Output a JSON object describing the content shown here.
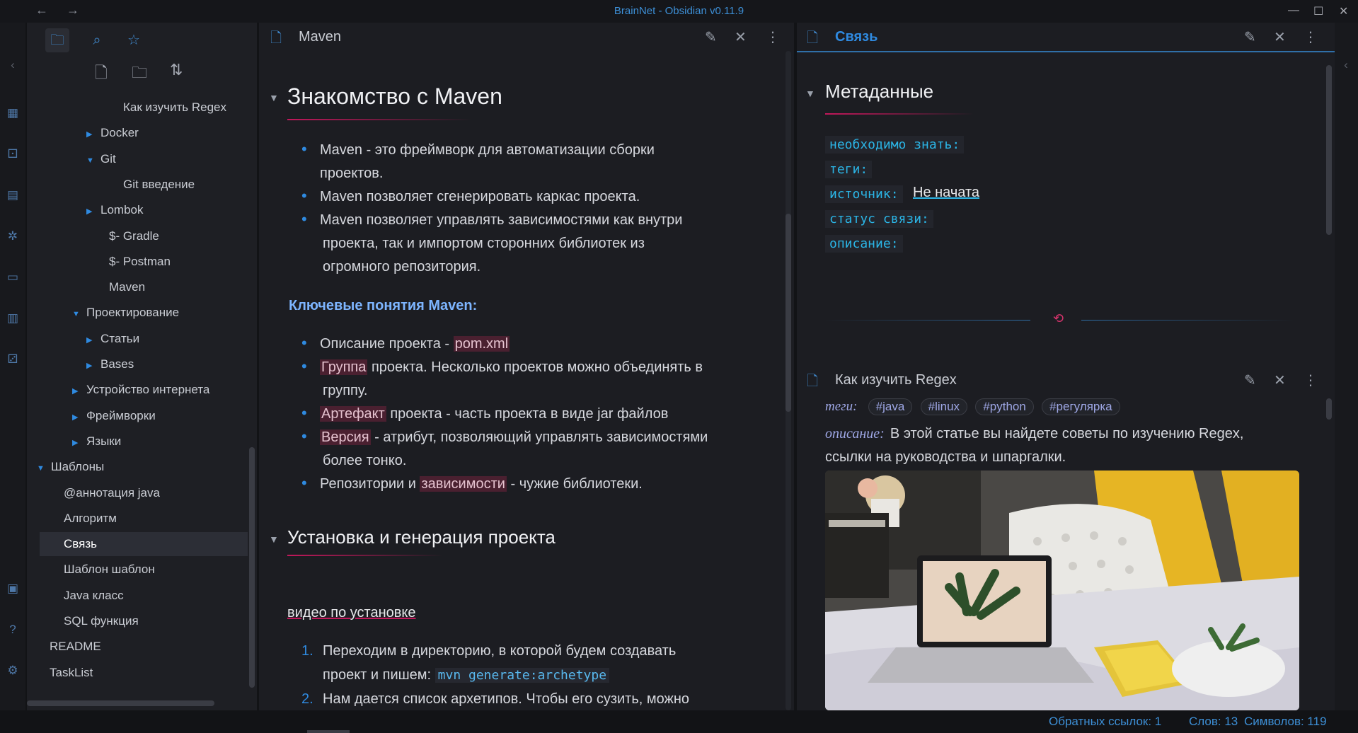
{
  "window": {
    "title": "BrainNet - Obsidian v0.11.9",
    "nav_back": "←",
    "nav_forward": "→",
    "minimize": "—",
    "maximize": "☐",
    "close": "✕"
  },
  "sidebar": {
    "tree": [
      {
        "label": "Как изучить Regex",
        "arrow": ""
      },
      {
        "label": "Docker",
        "arrow": "▶"
      },
      {
        "label": "Git",
        "arrow": "▼"
      },
      {
        "label": "Git введение",
        "arrow": ""
      },
      {
        "label": "Lombok",
        "arrow": "▶"
      },
      {
        "label": "$- Gradle",
        "arrow": ""
      },
      {
        "label": "$- Postman",
        "arrow": ""
      },
      {
        "label": "Maven",
        "arrow": ""
      },
      {
        "label": "Проектирование",
        "arrow": "▼"
      },
      {
        "label": "Статьи",
        "arrow": "▶"
      },
      {
        "label": "Bases",
        "arrow": "▶"
      },
      {
        "label": "Устройство интернета",
        "arrow": "▶"
      },
      {
        "label": "Фреймворки",
        "arrow": "▶"
      },
      {
        "label": "Языки",
        "arrow": "▶"
      },
      {
        "label": "Шаблоны",
        "arrow": "▼"
      },
      {
        "label": "@аннотация java",
        "arrow": ""
      },
      {
        "label": "Алгоритм",
        "arrow": ""
      },
      {
        "label": "Связь",
        "arrow": ""
      },
      {
        "label": "Шаблон шаблон",
        "arrow": ""
      },
      {
        "label": "Java класс",
        "arrow": ""
      },
      {
        "label": "SQL функция",
        "arrow": ""
      },
      {
        "label": "README",
        "arrow": ""
      },
      {
        "label": "TaskList",
        "arrow": ""
      }
    ]
  },
  "main": {
    "tab_title": "Maven",
    "h1": "Знакомство с Maven",
    "bullets1": [
      "Maven - это фреймворк для автоматизации сборки",
      "проектов.",
      "Maven позволяет сгенерировать каркас проекта.",
      "Maven позволяет управлять зависимостями как внутри",
      "проекта, так и импортом сторонних библиотек из",
      "огромного репозитория."
    ],
    "callout_title": "Ключевые понятия Maven:",
    "b2_1_pre": "Описание проекта - ",
    "b2_1_hl": "pom.xml",
    "b2_2_hl": "Группа",
    "b2_2_post": " проекта. Несколько проектов можно объединять в",
    "b2_2_cont": "группу.",
    "b2_3_hl": "Артефакт",
    "b2_3_post": " проекта - часть проекта в виде jar файлов",
    "b2_4_hl": "Версия",
    "b2_4_post": " - атрибут, позволяющий управлять зависимостями",
    "b2_4_cont": "более тонко.",
    "b2_5_pre": "Репозитории и ",
    "b2_5_hl": "зависимости",
    "b2_5_post": " - чужие библиотеки.",
    "h2": "Установка и генерация проекта",
    "video_link": "видео по установке",
    "ol1_num": "1.",
    "ol1_text": "Переходим в директорию, в которой будем создавать",
    "ol1_cont": "проект и пишем: ",
    "ol1_code": "mvn generate:archetype",
    "ol2_num": "2.",
    "ol2_text": "Нам дается список архетипов. Чтобы его сузить, можно"
  },
  "right_top": {
    "tab_title": "Связь",
    "heading": "Метаданные",
    "keys": [
      "необходимо знать:",
      "теги:",
      "источник:",
      "статус связи:",
      "описание:"
    ],
    "source_value": "Не начата",
    "link_icon": "⟲"
  },
  "right_bottom": {
    "tab_title": "Как изучить Regex",
    "tags_label": "теги:",
    "tags": [
      "#java",
      "#linux",
      "#python",
      "#регулярка"
    ],
    "desc_label": "описание:",
    "desc_text": "В этой статье вы найдете советы по изучению Regex,",
    "desc_cont": "ссылки на руководства и шпаргалки."
  },
  "status": {
    "backlinks": "Обратных ссылок: 1",
    "words": "Слов: 13",
    "chars": "Символов: 119"
  },
  "colors": {
    "accent": "#3d8fd6",
    "highlight_bg": "#4a2030",
    "link_underline": "#c2185b",
    "code": "#58b8ee"
  }
}
